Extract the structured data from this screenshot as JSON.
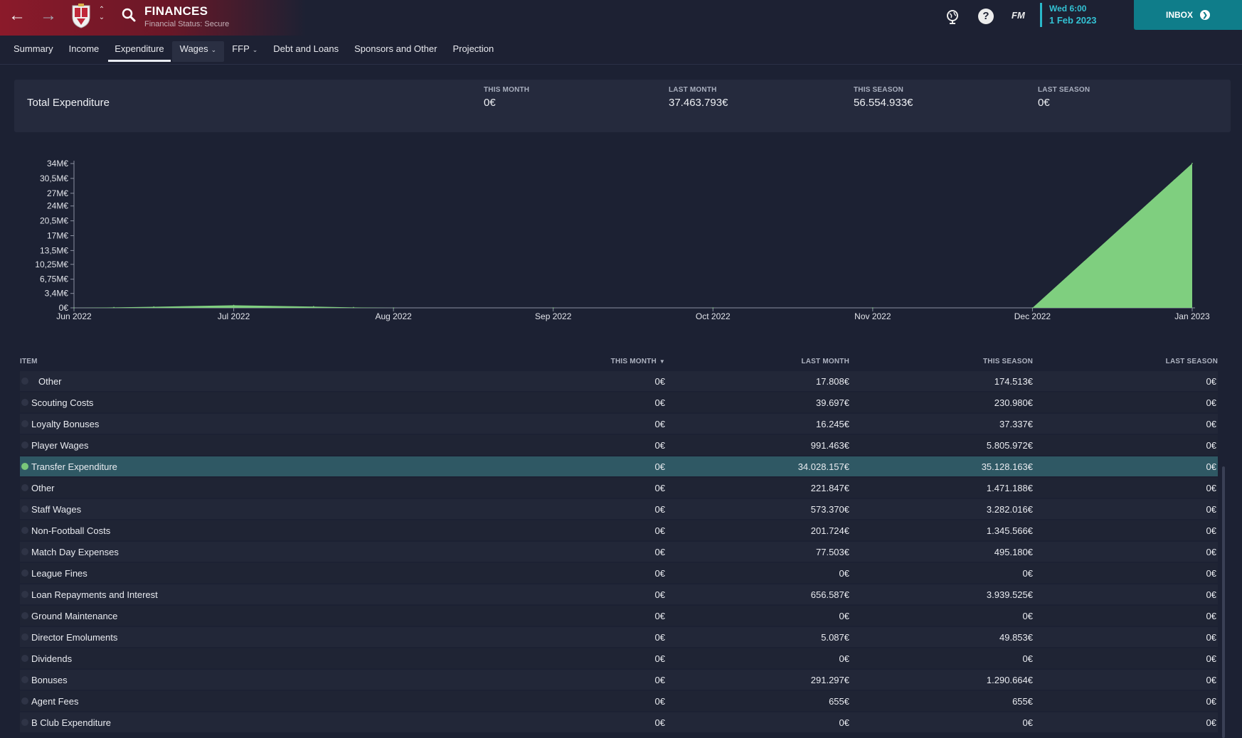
{
  "header": {
    "title": "FINANCES",
    "subtitle": "Financial Status: Secure",
    "date_day": "Wed 6:00",
    "date_full": "1 Feb 2023",
    "fm_label": "FM",
    "help_label": "?",
    "inbox_label": "INBOX"
  },
  "tabs": [
    {
      "label": "Summary"
    },
    {
      "label": "Income"
    },
    {
      "label": "Expenditure"
    },
    {
      "label": "Wages"
    },
    {
      "label": "FFP"
    },
    {
      "label": "Debt and Loans"
    },
    {
      "label": "Sponsors and Other"
    },
    {
      "label": "Projection"
    }
  ],
  "summary": {
    "label": "Total Expenditure",
    "stats": [
      {
        "key": "THIS MONTH",
        "value": "0€"
      },
      {
        "key": "LAST MONTH",
        "value": "37.463.793€"
      },
      {
        "key": "THIS SEASON",
        "value": "56.554.933€"
      },
      {
        "key": "LAST SEASON",
        "value": "0€"
      }
    ]
  },
  "chart_data": {
    "type": "area",
    "title": "",
    "xlabel": "",
    "ylabel": "",
    "x_tick_labels": [
      "Jun 2022",
      "Jul 2022",
      "Aug 2022",
      "Sep 2022",
      "Oct 2022",
      "Nov 2022",
      "Dec 2022",
      "Jan 2023"
    ],
    "y_tick_labels": [
      "0€",
      "3,4M€",
      "6,75M€",
      "10,25M€",
      "13,5M€",
      "17M€",
      "20,5M€",
      "24M€",
      "27M€",
      "30,5M€",
      "34M€"
    ],
    "y_tick_values": [
      0,
      3.4,
      6.75,
      10.25,
      13.5,
      17,
      20.5,
      24,
      27,
      30.5,
      34
    ],
    "ylim": [
      0,
      34
    ],
    "y_unit": "M€",
    "series": [
      {
        "color": "#7fcf7f",
        "x": [
          0,
          0.25,
          0.5,
          1,
          1.5,
          1.75,
          2,
          3,
          4,
          5,
          6,
          7
        ],
        "values": [
          0,
          0.1,
          0.25,
          0.6,
          0.3,
          0.1,
          0,
          0,
          0,
          0,
          0,
          34.03
        ]
      }
    ],
    "grid": false,
    "legend": "none"
  },
  "table": {
    "headers": {
      "item": "ITEM",
      "this_month": "THIS MONTH",
      "last_month": "LAST MONTH",
      "this_season": "THIS SEASON",
      "last_season": "LAST SEASON"
    },
    "rows": [
      {
        "item": "Other",
        "this_month": "0€",
        "last_month": "17.808€",
        "this_season": "174.513€",
        "last_season": "0€"
      },
      {
        "item": "Scouting Costs",
        "this_month": "0€",
        "last_month": "39.697€",
        "this_season": "230.980€",
        "last_season": "0€"
      },
      {
        "item": "Loyalty Bonuses",
        "this_month": "0€",
        "last_month": "16.245€",
        "this_season": "37.337€",
        "last_season": "0€"
      },
      {
        "item": "Player Wages",
        "this_month": "0€",
        "last_month": "991.463€",
        "this_season": "5.805.972€",
        "last_season": "0€"
      },
      {
        "item": "Transfer Expenditure",
        "this_month": "0€",
        "last_month": "34.028.157€",
        "this_season": "35.128.163€",
        "last_season": "0€"
      },
      {
        "item": "Other",
        "this_month": "0€",
        "last_month": "221.847€",
        "this_season": "1.471.188€",
        "last_season": "0€"
      },
      {
        "item": "Staff Wages",
        "this_month": "0€",
        "last_month": "573.370€",
        "this_season": "3.282.016€",
        "last_season": "0€"
      },
      {
        "item": "Non-Football Costs",
        "this_month": "0€",
        "last_month": "201.724€",
        "this_season": "1.345.566€",
        "last_season": "0€"
      },
      {
        "item": "Match Day Expenses",
        "this_month": "0€",
        "last_month": "77.503€",
        "this_season": "495.180€",
        "last_season": "0€"
      },
      {
        "item": "League Fines",
        "this_month": "0€",
        "last_month": "0€",
        "this_season": "0€",
        "last_season": "0€"
      },
      {
        "item": "Loan Repayments and Interest",
        "this_month": "0€",
        "last_month": "656.587€",
        "this_season": "3.939.525€",
        "last_season": "0€"
      },
      {
        "item": "Ground Maintenance",
        "this_month": "0€",
        "last_month": "0€",
        "this_season": "0€",
        "last_season": "0€"
      },
      {
        "item": "Director Emoluments",
        "this_month": "0€",
        "last_month": "5.087€",
        "this_season": "49.853€",
        "last_season": "0€"
      },
      {
        "item": "Dividends",
        "this_month": "0€",
        "last_month": "0€",
        "this_season": "0€",
        "last_season": "0€"
      },
      {
        "item": "Bonuses",
        "this_month": "0€",
        "last_month": "291.297€",
        "this_season": "1.290.664€",
        "last_season": "0€"
      },
      {
        "item": "Agent Fees",
        "this_month": "0€",
        "last_month": "655€",
        "this_season": "655€",
        "last_season": "0€"
      },
      {
        "item": "B Club Expenditure",
        "this_month": "0€",
        "last_month": "0€",
        "this_season": "0€",
        "last_season": "0€"
      }
    ]
  },
  "colors": {
    "background": "#1c2133",
    "accent_teal": "#0f7d8a",
    "date_cyan": "#33c2d4",
    "header_red": "#8b1a2a",
    "chart_fill": "#7fcf7f",
    "selected_row": "#2f5864"
  },
  "icons": [
    "back-arrow-icon",
    "forward-arrow-icon",
    "club-crest-icon",
    "up-down-chevron-icon",
    "search-icon",
    "globe-icon",
    "help-icon",
    "inbox-arrow-icon"
  ]
}
